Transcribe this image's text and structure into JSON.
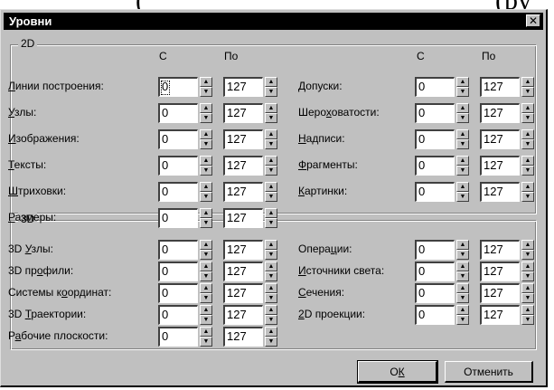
{
  "background_fragment": {
    "left": "(",
    "right": "(py"
  },
  "dialog": {
    "title": "Уровни",
    "close_label": "✕",
    "col_from": "С",
    "col_to": "По"
  },
  "group2d": {
    "title": "2D",
    "left": [
      {
        "pre": "",
        "mn": "Л",
        "post": "инии построения:",
        "from": "0",
        "to": "127",
        "focused": true
      },
      {
        "pre": "",
        "mn": "У",
        "post": "злы:",
        "from": "0",
        "to": "127"
      },
      {
        "pre": "",
        "mn": "И",
        "post": "зображения:",
        "from": "0",
        "to": "127"
      },
      {
        "pre": "",
        "mn": "Т",
        "post": "ексты:",
        "from": "0",
        "to": "127"
      },
      {
        "pre": "",
        "mn": "Ш",
        "post": "триховки:",
        "from": "0",
        "to": "127"
      },
      {
        "pre": "",
        "mn": "Р",
        "post": "азмеры:",
        "from": "0",
        "to": "127"
      }
    ],
    "right": [
      {
        "pre": "",
        "mn": "Д",
        "post": "опуски:",
        "from": "0",
        "to": "127"
      },
      {
        "pre": "Шеро",
        "mn": "х",
        "post": "оватости:",
        "from": "0",
        "to": "127"
      },
      {
        "pre": "",
        "mn": "Н",
        "post": "адписи:",
        "from": "0",
        "to": "127"
      },
      {
        "pre": "",
        "mn": "Ф",
        "post": "рагменты:",
        "from": "0",
        "to": "127"
      },
      {
        "pre": "",
        "mn": "К",
        "post": "артинки:",
        "from": "0",
        "to": "127"
      }
    ]
  },
  "group3d": {
    "title": "3D",
    "left": [
      {
        "pre": "3D ",
        "mn": "У",
        "post": "злы:",
        "from": "0",
        "to": "127"
      },
      {
        "pre": "3D пр",
        "mn": "о",
        "post": "фили:",
        "from": "0",
        "to": "127"
      },
      {
        "pre": "Системы к",
        "mn": "о",
        "post": "ординат:",
        "from": "0",
        "to": "127"
      },
      {
        "pre": "3D ",
        "mn": "Т",
        "post": "раектории:",
        "from": "0",
        "to": "127"
      },
      {
        "pre": "Р",
        "mn": "а",
        "post": "бочие плоскости:",
        "from": "0",
        "to": "127"
      }
    ],
    "right": [
      {
        "pre": "Опера",
        "mn": "ц",
        "post": "ии:",
        "from": "0",
        "to": "127"
      },
      {
        "pre": "",
        "mn": "И",
        "post": "сточники света:",
        "from": "0",
        "to": "127"
      },
      {
        "pre": "",
        "mn": "С",
        "post": "ечения:",
        "from": "0",
        "to": "127"
      },
      {
        "pre": "",
        "mn": "2",
        "post": "D проекции:",
        "from": "0",
        "to": "127"
      }
    ]
  },
  "buttons": {
    "ok": {
      "pre": "О",
      "mn": "К",
      "post": ""
    },
    "cancel": {
      "pre": "",
      "mn": "",
      "post": "Отменить"
    }
  }
}
